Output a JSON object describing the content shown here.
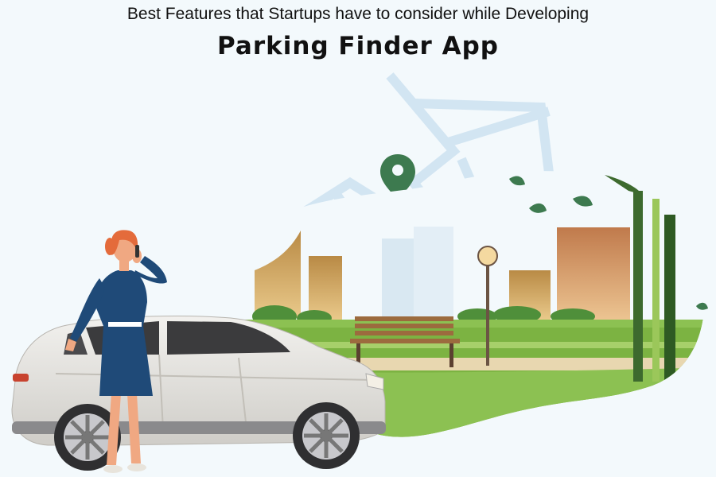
{
  "header": {
    "subtitle": "Best Features that Startups have to consider while Developing",
    "title": "Parking Finder App"
  },
  "colors": {
    "background": "#f3f9fc",
    "grass": "#7cb342",
    "car_body": "#e6e4e0",
    "dress": "#1f4a78",
    "pin": "#3d7a4f",
    "map_lines": "#cfe3f1"
  },
  "icons": [
    "location-pin-icon"
  ]
}
